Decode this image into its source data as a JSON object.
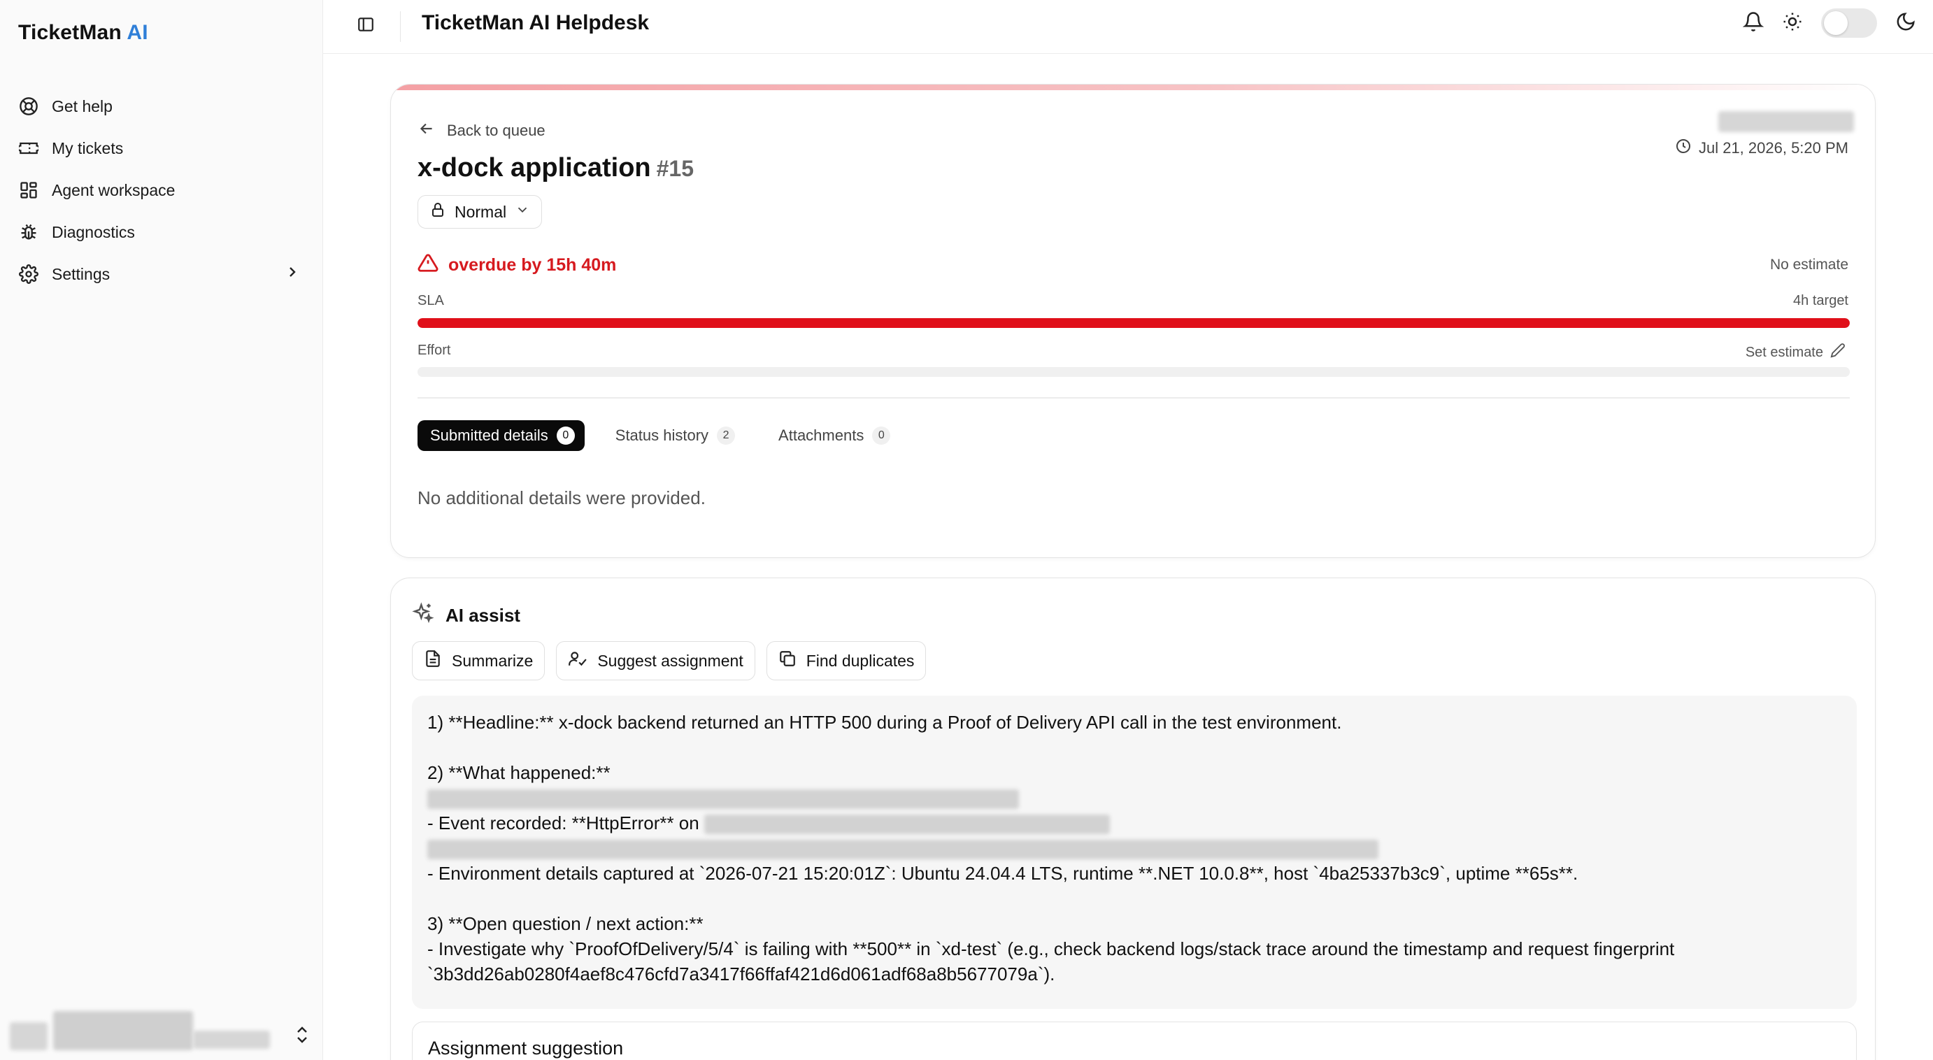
{
  "app": {
    "brand_main": "TicketMan",
    "brand_accent": "AI",
    "accent_color": "#2f7fd8",
    "header_title": "TicketMan AI Helpdesk"
  },
  "sidebar": {
    "items": [
      {
        "label": "Get help",
        "icon": "lifebuoy-icon"
      },
      {
        "label": "My tickets",
        "icon": "ticket-icon"
      },
      {
        "label": "Agent workspace",
        "icon": "dashboard-grid-icon"
      },
      {
        "label": "Diagnostics",
        "icon": "bug-icon"
      },
      {
        "label": "Settings",
        "icon": "gear-icon",
        "has_submenu": true
      }
    ]
  },
  "topbar": {
    "icons": [
      "bell-icon",
      "sun-icon",
      "theme-toggle",
      "moon-icon"
    ],
    "dark_mode": false
  },
  "ticket": {
    "back_label": "Back to queue",
    "title": "x-dock application",
    "number": "#15",
    "priority": "Normal",
    "date": "Jul 21, 2026, 5:20 PM",
    "overdue_text": "overdue by 15h 40m",
    "estimate_text": "No estimate",
    "sla_label": "SLA",
    "sla_target": "4h target",
    "sla_progress": 1.0,
    "sla_color": "#e0101a",
    "effort_label": "Effort",
    "effort_progress": 0,
    "set_estimate_label": "Set estimate",
    "tabs": [
      {
        "label": "Submitted details",
        "count": "0",
        "active": true
      },
      {
        "label": "Status history",
        "count": "2",
        "active": false
      },
      {
        "label": "Attachments",
        "count": "0",
        "active": false
      }
    ],
    "empty_details": "No additional details were provided."
  },
  "ai": {
    "title": "AI assist",
    "actions": [
      {
        "label": "Summarize",
        "icon": "document-icon"
      },
      {
        "label": "Suggest assignment",
        "icon": "user-assign-icon"
      },
      {
        "label": "Find duplicates",
        "icon": "copy-icon"
      }
    ],
    "output": {
      "line1": "1) **Headline:** x-dock backend returned an HTTP 500 during a Proof of Delivery API call in the test environment.",
      "line2": "2) **What happened:**",
      "line3": "- Event recorded: **HttpError** on",
      "line4": "- Environment details captured at `2026-07-21 15:20:01Z`: Ubuntu 24.04.4 LTS, runtime **.NET 10.0.8**, host `4ba25337b3c9`, uptime **65s**.",
      "line5": "3) **Open question / next action:**",
      "line6": "- Investigate why `ProofOfDelivery/5/4` is failing with **500** in `xd-test` (e.g., check backend logs/stack trace around the timestamp and request fingerprint `3b3dd26ab0280f4aef8c476cfd7a3417f66ffaf421d6d061adf68a8b5677079a`)."
    },
    "assignment_title": "Assignment suggestion"
  }
}
